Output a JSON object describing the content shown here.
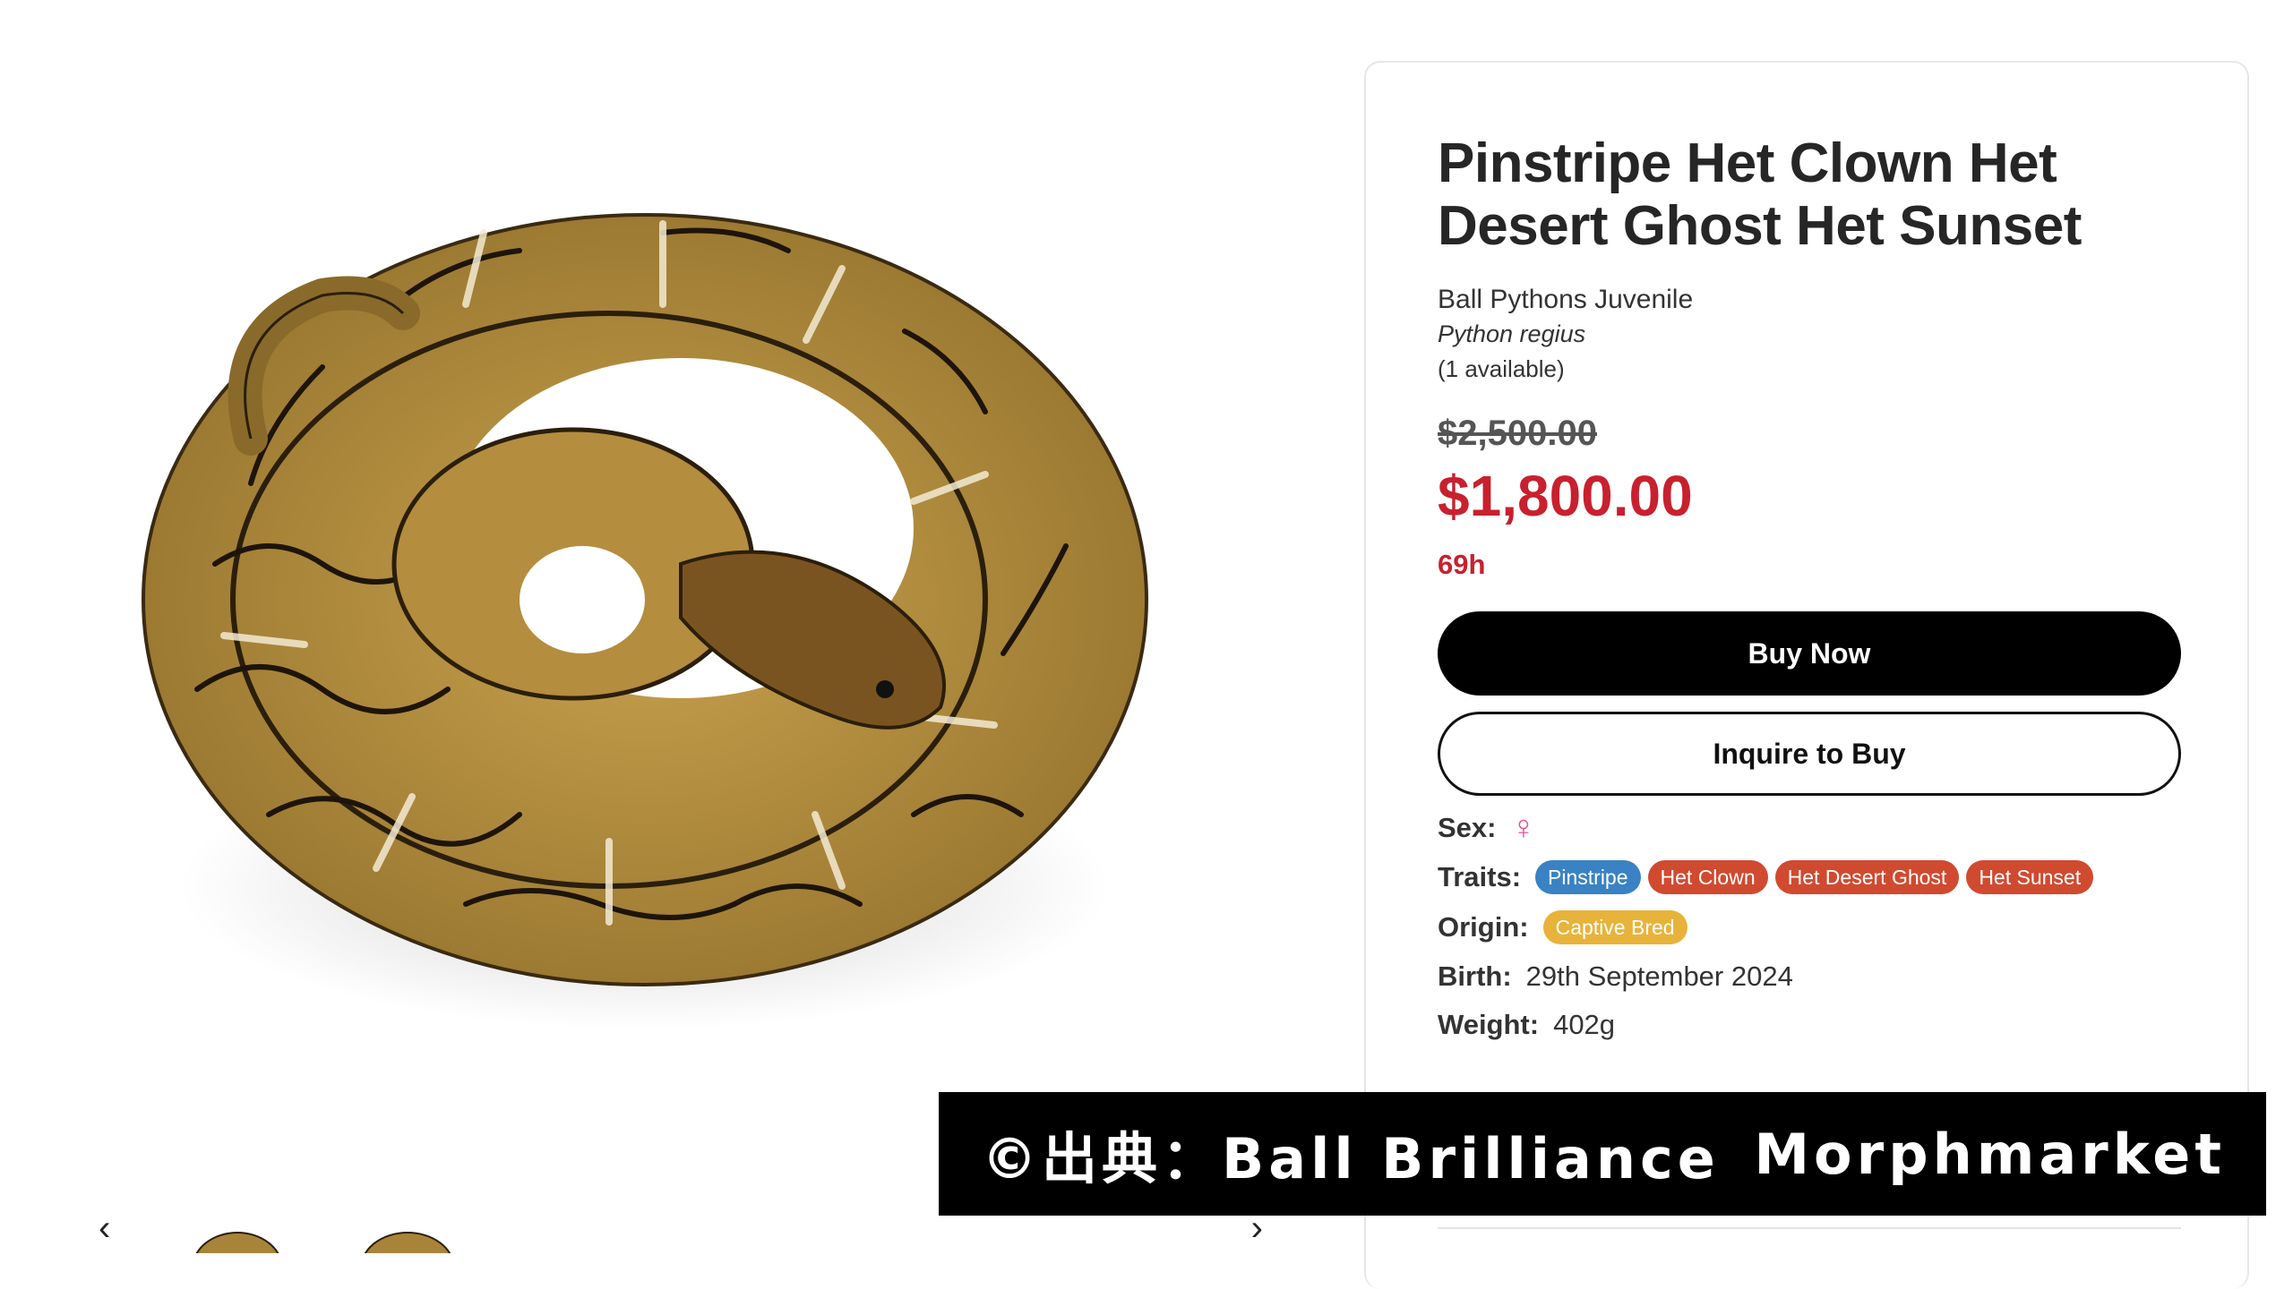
{
  "product": {
    "title": "Pinstripe Het Clown Het Desert Ghost Het Sunset",
    "category": "Ball Pythons Juvenile",
    "scientific_name": "Python regius",
    "availability": "(1 available)",
    "original_price": "$2,500.00",
    "sale_price": "$1,800.00",
    "time_left": "69h"
  },
  "actions": {
    "buy_now": "Buy Now",
    "inquire": "Inquire to Buy"
  },
  "details": {
    "sex_label": "Sex:",
    "sex_symbol": "♀",
    "traits_label": "Traits:",
    "traits": [
      {
        "name": "Pinstripe",
        "color": "#3a82c4"
      },
      {
        "name": "Het Clown",
        "color": "#d04a30"
      },
      {
        "name": "Het Desert Ghost",
        "color": "#d04a30"
      },
      {
        "name": "Het Sunset",
        "color": "#d04a30"
      }
    ],
    "origin_label": "Origin:",
    "origin": "Captive Bred",
    "birth_label": "Birth:",
    "birth": "29th September 2024",
    "weight_label": "Weight:",
    "weight": "402g"
  },
  "gallery": {
    "prev_arrow": "‹",
    "next_arrow": "›"
  },
  "banner": {
    "source": "©出典：Ball Brilliance",
    "site": "Morphmarket"
  },
  "colors": {
    "sale_red": "#c8202e",
    "buy_button": "#000000"
  }
}
